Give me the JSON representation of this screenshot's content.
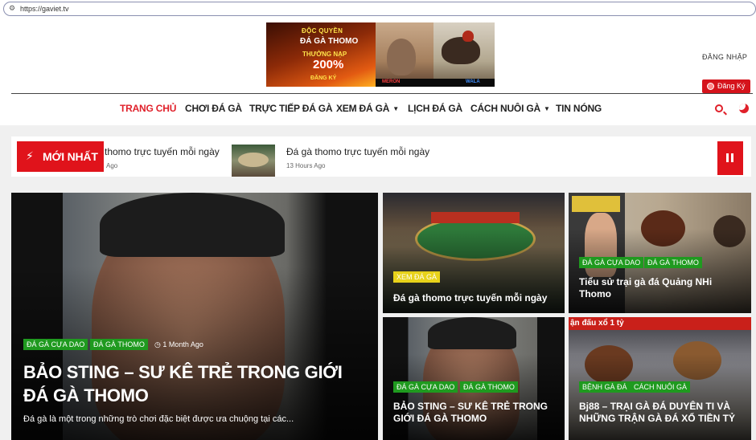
{
  "browser": {
    "url": "https://gaviet.tv"
  },
  "banner": {
    "line1": "ĐỘC QUYỀN",
    "line2": "ĐÁ GÀ THOMO",
    "line3": "THƯỞNG NẠP",
    "line4": "200%",
    "line5": "ĐĂNG KÝ",
    "meron": "MERON",
    "wala": "WALA"
  },
  "header": {
    "login": "ĐĂNG NHẬP",
    "register": "Đăng Ký"
  },
  "nav": {
    "items": [
      {
        "label": "TRANG CHỦ"
      },
      {
        "label": "CHƠI ĐÁ GÀ"
      },
      {
        "label": "TRỰC TIẾP ĐÁ GÀ"
      },
      {
        "label": "XEM ĐÁ GÀ"
      },
      {
        "label": "LỊCH ĐÁ GÀ"
      },
      {
        "label": "CÁCH NUÔI GÀ"
      },
      {
        "label": "TIN NÓNG"
      }
    ]
  },
  "ticker": {
    "label": "MỚI NHẤT",
    "items": [
      {
        "title": "thomo trực tuyến mỗi ngày",
        "time": "Ago"
      },
      {
        "title": "Đá gà thomo trực tuyến mỗi ngày",
        "time": "13 Hours Ago"
      }
    ]
  },
  "featured": {
    "tags": [
      "ĐÁ GÀ CỰA DAO",
      "ĐÁ GÀ THOMO"
    ],
    "time": "1 Month Ago",
    "title": "BẢO STING – SƯ KÊ TRẺ TRONG GIỚI ĐÁ GÀ THOMO",
    "excerpt": "Đá gà là một trong những trò chơi đặc biệt được ưa chuộng tại các..."
  },
  "cards": [
    {
      "tags": [
        "XEM ĐÁ GÀ"
      ],
      "title": "Đá gà thomo trực tuyến mỗi ngày"
    },
    {
      "tags": [
        "ĐÁ GÀ CỰA DAO",
        "ĐÁ GÀ THOMO"
      ],
      "title": "Tiểu sử trại gà đá Quảng NHi Thomo"
    },
    {
      "tags": [
        "ĐÁ GÀ CỰA DAO",
        "ĐÁ GÀ THOMO"
      ],
      "title": "BẢO STING – SƯ KÊ TRẺ TRONG GIỚI ĐÁ GÀ THOMO"
    },
    {
      "tags": [
        "BỆNH GÀ ĐÁ",
        "CÁCH NUÔI GÀ"
      ],
      "title": "Bj88 – TRẠI GÀ ĐÁ DUYÊN TI VÀ NHỮNG TRẬN GÀ ĐÁ XỔ TIỀN TỶ",
      "overlay_text": "ận đấu xổ 1 tỷ"
    }
  ]
}
